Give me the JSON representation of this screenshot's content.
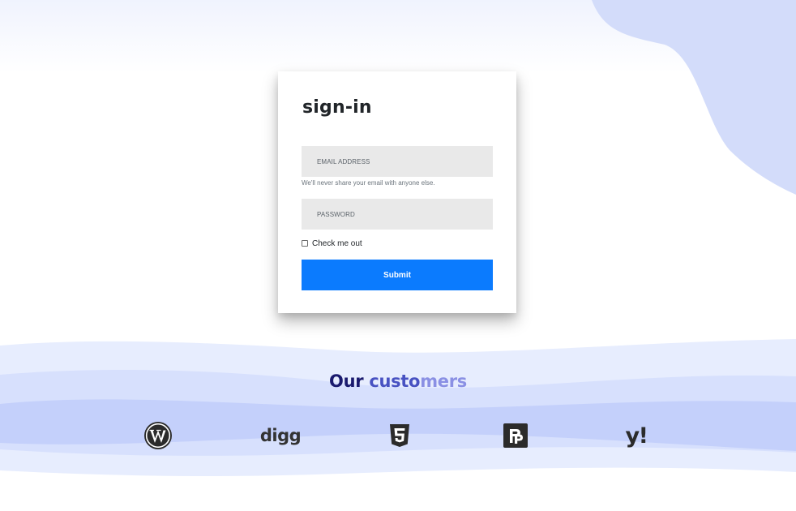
{
  "signin": {
    "title": "sign-in",
    "email_placeholder": "EMAIL ADDRESS",
    "email_help": "We'll never share your email with anyone else.",
    "password_placeholder": "PASSWORD",
    "remember_label": "Check me out",
    "remember_checked": false,
    "submit_label": "Submit"
  },
  "customers": {
    "title_part1": "Our ",
    "title_part2": "custo",
    "title_part3": "mers",
    "logos": [
      {
        "name": "wordpress",
        "icon": "wordpress-icon"
      },
      {
        "name": "digg",
        "icon": "digg-icon",
        "text": "digg"
      },
      {
        "name": "html5",
        "icon": "html5-icon"
      },
      {
        "name": "product-hunt",
        "icon": "pp-icon"
      },
      {
        "name": "yahoo",
        "icon": "yahoo-icon",
        "text": "y!"
      }
    ]
  },
  "colors": {
    "accent": "#0b7bfe",
    "blob": "#d3dcfa",
    "wave_light": "#e7edfe",
    "wave_mid": "#d7e0fd",
    "wave_dark": "#c4d0fb",
    "field_bg": "#e9e9e9",
    "title_dark": "#1a1a6e"
  }
}
